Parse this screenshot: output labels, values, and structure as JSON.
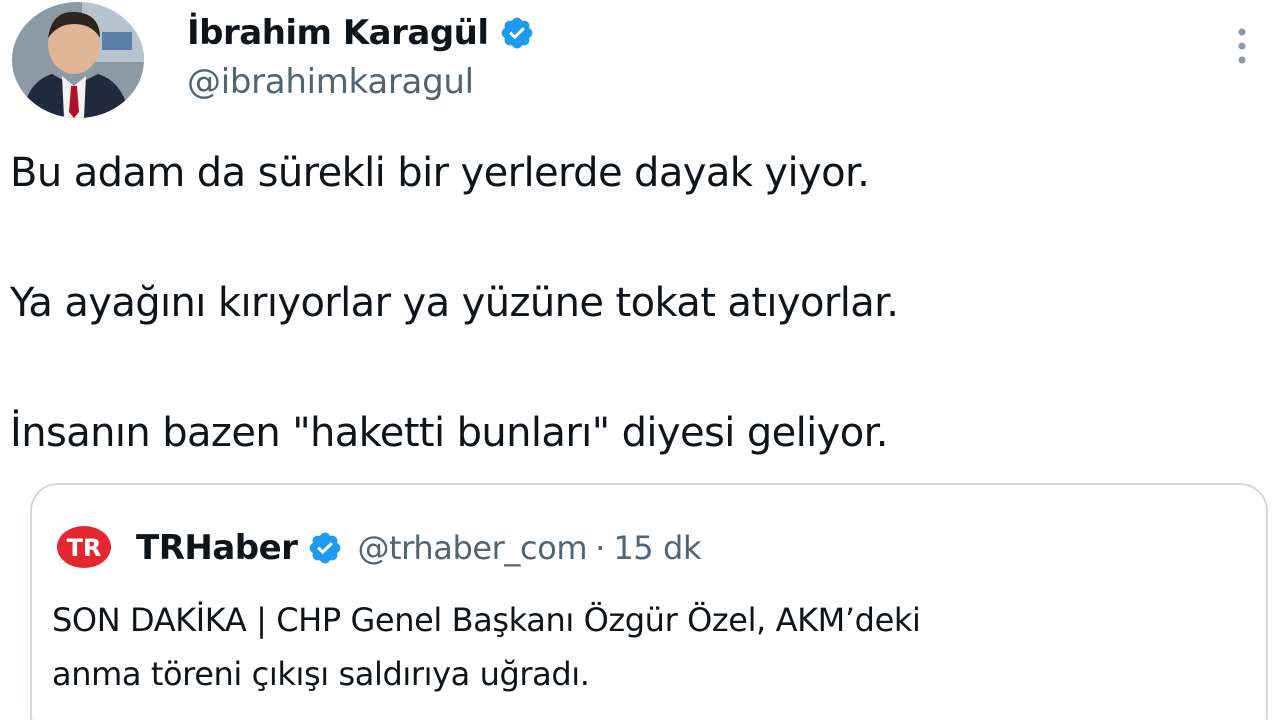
{
  "author": {
    "display_name": "İbrahim Karagül",
    "handle": "@ibrahimkaragul",
    "verified_icon": "verified-badge-icon",
    "avatar_icon": "avatar-photo"
  },
  "menu": {
    "more_icon": "more-vertical-icon"
  },
  "tweet": {
    "lines": [
      "Bu adam da sürekli bir yerlerde dayak yiyor.",
      "Ya ayağını kırıyorlar ya yüzüne tokat atıyorlar.",
      "İnsanın bazen \"haketti bunları\" diyesi geliyor."
    ]
  },
  "quoted": {
    "logo_text": "TR",
    "name": "TRHaber",
    "handle": "@trhaber_com",
    "separator": "·",
    "time": "15 dk",
    "text_lines": [
      "SON DAKİKA | CHP Genel Başkanı Özgür Özel, AKM’deki",
      "anma töreni çıkışı saldırıya uğradı."
    ]
  },
  "colors": {
    "text_primary": "#0f1419",
    "text_secondary": "#536471",
    "verified_blue": "#1d9bf0",
    "border": "#cfd9de",
    "trhaber_red": "#e3262f"
  }
}
